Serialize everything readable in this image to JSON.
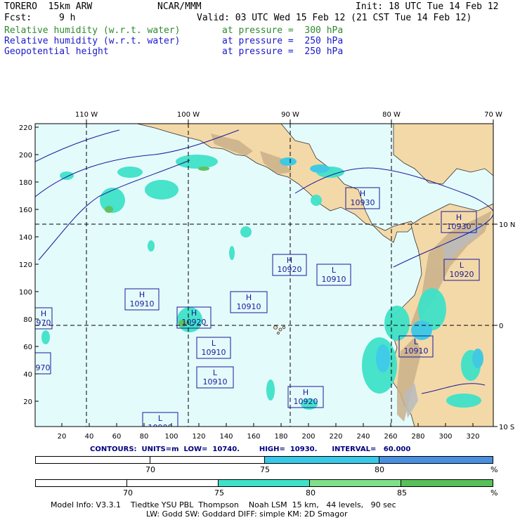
{
  "header": {
    "model": "TORERO  15km ARW",
    "org": "NCAR/MMM",
    "init": "Init: 18 UTC Tue 14 Feb 12",
    "fcst_label": "Fcst:",
    "fcst_value": "9 h",
    "valid": "Valid: 03 UTC Wed 15 Feb 12 (21 CST Tue 14 Feb 12)"
  },
  "fields": [
    {
      "name": "Relative humidity (w.r.t. water)",
      "level": "at pressure =  300 hPa",
      "color": "#2e8b2e"
    },
    {
      "name": "Relative humidity (w.r.t. water)",
      "level": "at pressure =  250 hPa",
      "color": "#1a1acc"
    },
    {
      "name": "Geopotential height",
      "level": "at pressure =  250 hPa",
      "color": "#1a1acc"
    }
  ],
  "map": {
    "top_lon_labels": [
      "110 W",
      "100 W",
      "90 W",
      "80 W",
      "70 W"
    ],
    "right_lat_labels": [
      "10 N",
      "0",
      "10 S"
    ],
    "left_grid_labels": [
      "220",
      "200",
      "180",
      "160",
      "140",
      "120",
      "100",
      "80",
      "60",
      "40",
      "20"
    ],
    "bottom_grid_labels": [
      "20",
      "40",
      "60",
      "80",
      "100",
      "120",
      "140",
      "160",
      "180",
      "200",
      "220",
      "240",
      "260",
      "280",
      "300",
      "320"
    ],
    "colors": {
      "ocean": "#e4fbfc",
      "land": "#f3d9a8",
      "terrain": "#c9b08a",
      "high_terrain": "#bbbbbb",
      "rh_70": "#38c9e8",
      "rh_75": "#3fe2c8",
      "rh_80": "#7fe08a",
      "rh_85": "#58c058",
      "contour": "#1a1a99"
    },
    "centers": [
      {
        "type": "H",
        "value": "10930"
      },
      {
        "type": "H",
        "value": "10930"
      },
      {
        "type": "H",
        "value": "10920"
      },
      {
        "type": "L",
        "value": "10910"
      },
      {
        "type": "L",
        "value": "10920"
      },
      {
        "type": "H",
        "value": "10910"
      },
      {
        "type": "H",
        "value": "10920"
      },
      {
        "type": "L",
        "value": "10910"
      },
      {
        "type": "L",
        "value": "10910"
      },
      {
        "type": "L",
        "value": "10910"
      },
      {
        "type": "H",
        "value": "10910"
      },
      {
        "type": "H",
        "value": "10920"
      },
      {
        "type": "H",
        "value": "970"
      },
      {
        "type": "",
        "value": "970"
      },
      {
        "type": "L",
        "value": "10900"
      }
    ]
  },
  "contours_info": "CONTOURS:  UNITS=m  LOW=  10740.        HIGH=  10930.      INTERVAL=   60.000",
  "legend_bars": [
    {
      "ticks": [
        "70",
        "75",
        "80"
      ],
      "unit": "%",
      "segment_colors": [
        "#ffffff",
        "#ffffff",
        "#38c9e8",
        "#4a90e2"
      ]
    },
    {
      "ticks": [
        "70",
        "75",
        "80",
        "85"
      ],
      "unit": "%",
      "segment_colors": [
        "#ffffff",
        "#ffffff",
        "#3fe2c8",
        "#7fe08a",
        "#58c058"
      ]
    }
  ],
  "footer": {
    "line1": "Model Info: V3.3.1    Tiedtke YSU PBL  Thompson    Noah LSM  15 km,   44 levels,   90 sec",
    "line2": "LW: Godd SW: Goddard DIFF: simple KM: 2D Smagor"
  }
}
